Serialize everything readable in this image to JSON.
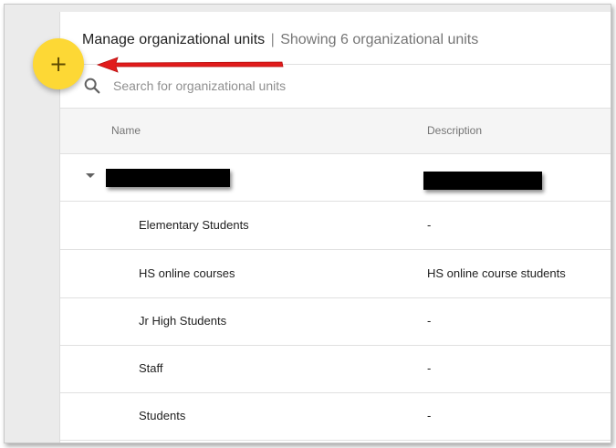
{
  "header": {
    "title": "Manage organizational units",
    "separator": "|",
    "count_text": "Showing 6 organizational units"
  },
  "search": {
    "placeholder": "Search for organizational units",
    "icon": "search-icon"
  },
  "fab": {
    "label": "+",
    "color": "#fdd835"
  },
  "table": {
    "columns": [
      "Name",
      "Description"
    ],
    "rows": [
      {
        "name": "Elementary Students",
        "description": "-"
      },
      {
        "name": "HS online courses",
        "description": "HS online course students"
      },
      {
        "name": "Jr High Students",
        "description": "-"
      },
      {
        "name": "Staff",
        "description": "-"
      },
      {
        "name": "Students",
        "description": "-"
      }
    ]
  },
  "annotation": {
    "arrow_color": "#e11b1b"
  }
}
